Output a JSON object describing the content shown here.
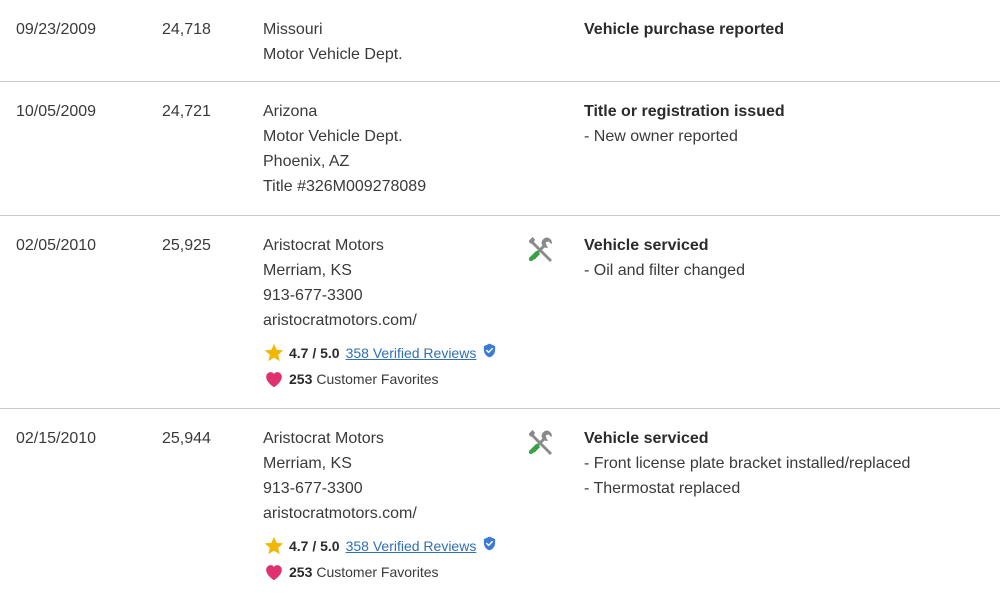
{
  "records": [
    {
      "date": "09/23/2009",
      "mileage": "24,718",
      "source": [
        "Missouri",
        "Motor Vehicle Dept."
      ],
      "has_service_icon": false,
      "event": "Vehicle purchase reported",
      "details": []
    },
    {
      "date": "10/05/2009",
      "mileage": "24,721",
      "source": [
        "Arizona",
        "Motor Vehicle Dept.",
        "Phoenix, AZ",
        "Title #326M009278089"
      ],
      "has_service_icon": false,
      "event": "Title or registration issued",
      "details": [
        "- New owner reported"
      ]
    },
    {
      "date": "02/05/2010",
      "mileage": "25,925",
      "source": [
        "Aristocrat Motors",
        "Merriam, KS",
        "913-677-3300",
        "aristocratmotors.com/"
      ],
      "has_service_icon": true,
      "rating": {
        "value": "4.7 / 5.0",
        "reviews_label": "358 Verified Reviews"
      },
      "favorites": {
        "count": "253",
        "label": "Customer Favorites"
      },
      "event": "Vehicle serviced",
      "details": [
        "- Oil and filter changed"
      ]
    },
    {
      "date": "02/15/2010",
      "mileage": "25,944",
      "source": [
        "Aristocrat Motors",
        "Merriam, KS",
        "913-677-3300",
        "aristocratmotors.com/"
      ],
      "has_service_icon": true,
      "rating": {
        "value": "4.7 / 5.0",
        "reviews_label": "358 Verified Reviews"
      },
      "favorites": {
        "count": "253",
        "label": "Customer Favorites"
      },
      "event": "Vehicle serviced",
      "details": [
        "- Front license plate bracket installed/replaced",
        "- Thermostat replaced"
      ]
    }
  ],
  "icons": {
    "service": "wrench-screwdriver-icon",
    "rating": "star-icon",
    "verified": "verified-shield-icon",
    "favorite": "heart-icon"
  },
  "colors": {
    "link": "#2f6fb6",
    "star": "#f2b705",
    "heart": "#e0306f",
    "verified": "#3b7bd4",
    "divider": "#c8c8c8"
  }
}
